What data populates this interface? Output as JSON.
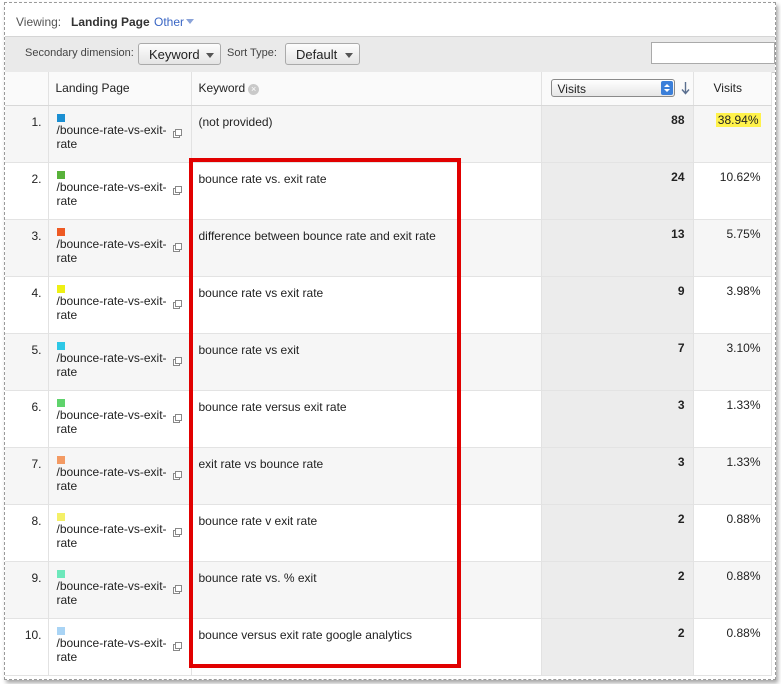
{
  "viewing": {
    "label": "Viewing:",
    "current": "Landing Page",
    "other": "Other"
  },
  "toolbar": {
    "secondary_label": "Secondary dimension:",
    "secondary_value": "Keyword",
    "sort_label": "Sort Type:",
    "sort_value": "Default",
    "search_value": ""
  },
  "table": {
    "headers": {
      "landing_page": "Landing Page",
      "keyword": "Keyword",
      "visits_select": "Visits",
      "visits": "Visits"
    },
    "rows": [
      {
        "index": "1.",
        "landing_page": "/bounce-rate-vs-exit-rate",
        "lp_line1": "/bounce-rate-vs-exit-",
        "lp_line2": "rate",
        "keyword": "(not provided)",
        "visits": "88",
        "pct": "38.94%",
        "color": "#1b8fd2"
      },
      {
        "index": "2.",
        "landing_page": "/bounce-rate-vs-exit-rate",
        "lp_line1": "/bounce-rate-vs-exit-",
        "lp_line2": "rate",
        "keyword": "bounce rate vs. exit rate",
        "visits": "24",
        "pct": "10.62%",
        "color": "#58b23a"
      },
      {
        "index": "3.",
        "landing_page": "/bounce-rate-vs-exit-rate",
        "lp_line1": "/bounce-rate-vs-exit-",
        "lp_line2": "rate",
        "keyword": "difference between bounce rate and exit rate",
        "visits": "13",
        "pct": "5.75%",
        "color": "#ee5a24"
      },
      {
        "index": "4.",
        "landing_page": "/bounce-rate-vs-exit-rate",
        "lp_line1": "/bounce-rate-vs-exit-",
        "lp_line2": "rate",
        "keyword": "bounce rate vs exit rate",
        "visits": "9",
        "pct": "3.98%",
        "color": "#eef014"
      },
      {
        "index": "5.",
        "landing_page": "/bounce-rate-vs-exit-rate",
        "lp_line1": "/bounce-rate-vs-exit-",
        "lp_line2": "rate",
        "keyword": "bounce rate vs exit",
        "visits": "7",
        "pct": "3.10%",
        "color": "#2ec8e6"
      },
      {
        "index": "6.",
        "landing_page": "/bounce-rate-vs-exit-rate",
        "lp_line1": "/bounce-rate-vs-exit-",
        "lp_line2": "rate",
        "keyword": "bounce rate versus exit rate",
        "visits": "3",
        "pct": "1.33%",
        "color": "#5fd36c"
      },
      {
        "index": "7.",
        "landing_page": "/bounce-rate-vs-exit-rate",
        "lp_line1": "/bounce-rate-vs-exit-",
        "lp_line2": "rate",
        "keyword": "exit rate vs bounce rate",
        "visits": "3",
        "pct": "1.33%",
        "color": "#f39a63"
      },
      {
        "index": "8.",
        "landing_page": "/bounce-rate-vs-exit-rate",
        "lp_line1": "/bounce-rate-vs-exit-",
        "lp_line2": "rate",
        "keyword": "bounce rate v exit rate",
        "visits": "2",
        "pct": "0.88%",
        "color": "#f4f067"
      },
      {
        "index": "9.",
        "landing_page": "/bounce-rate-vs-exit-rate",
        "lp_line1": "/bounce-rate-vs-exit-",
        "lp_line2": "rate",
        "keyword": "bounce rate vs. % exit",
        "visits": "2",
        "pct": "0.88%",
        "color": "#6de8bb"
      },
      {
        "index": "10.",
        "landing_page": "/bounce-rate-vs-exit-rate",
        "lp_line1": "/bounce-rate-vs-exit-",
        "lp_line2": "rate",
        "keyword": "bounce versus exit rate google analytics",
        "visits": "2",
        "pct": "0.88%",
        "color": "#a9d4f5"
      }
    ]
  },
  "highlight_color": "#fff24b",
  "annotation_color": "#e10000"
}
